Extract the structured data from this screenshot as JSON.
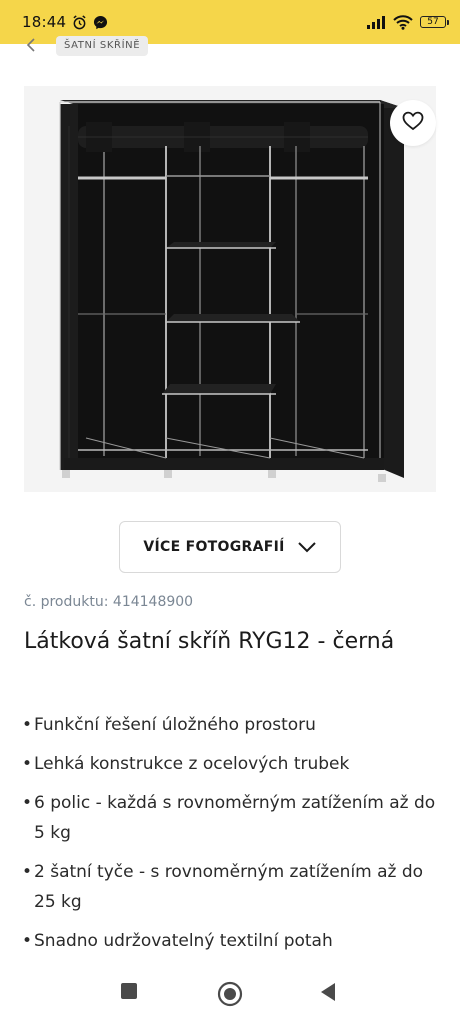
{
  "status_bar": {
    "time": "18:44",
    "battery": "57",
    "icons": [
      "alarm-icon",
      "messenger-icon",
      "signal-icon",
      "wifi-icon",
      "battery-icon"
    ]
  },
  "breadcrumb": {
    "label": "ŠATNÍ SKŘÍNĚ"
  },
  "product": {
    "image_alt": "Látková šatní skříň",
    "more_photos_label": "VÍCE FOTOGRAFIÍ",
    "code_prefix": "č. produktu: ",
    "code_value": "414148900",
    "title": "Látková šatní skříň RYG12 - černá",
    "features": [
      "Funkční řešení úložného prostoru",
      "Lehká konstrukce z ocelových trubek",
      "6 polic - každá s rovnoměrným zatížením až do 5 kg",
      "2 šatní tyče - s rovnoměrným zatížením až do 25 kg",
      "Snadno udržovatelný textilní potah"
    ]
  },
  "colors": {
    "status_bar_bg": "#f5d64a",
    "code_text": "#7b8794",
    "image_bg": "#f4f4f4"
  }
}
